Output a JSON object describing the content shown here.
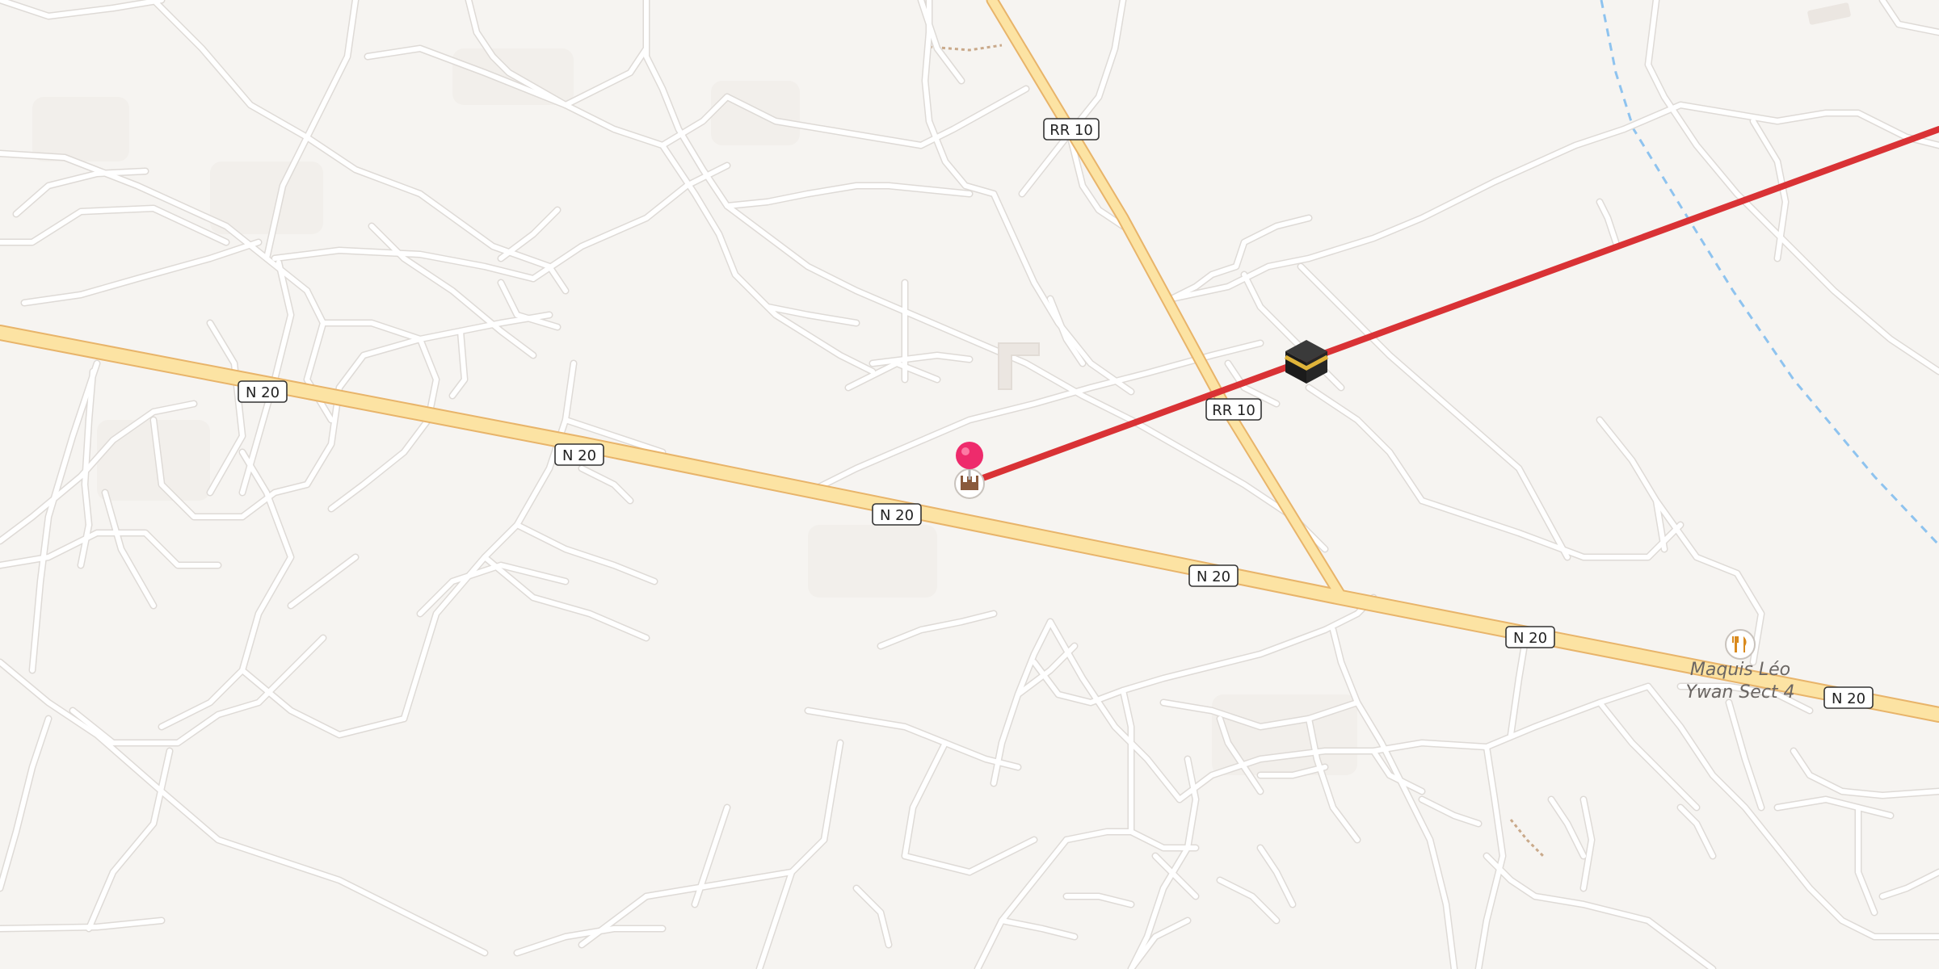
{
  "map": {
    "colors": {
      "background": "#f6f4f1",
      "minor_road": "#ffffff",
      "minor_road_casing": "#dedad6",
      "major_road_fill": "#fce3a3",
      "major_road_casing": "#e8b46a",
      "qibla_line": "#d93235",
      "waterway": "#8ec3ef",
      "pin": "#ee2b6c"
    },
    "road_labels": {
      "rr10_north": "RR 10",
      "rr10_center": "RR 10",
      "n20_west": "N 20",
      "n20_mid": "N 20",
      "n20_center": "N 20",
      "n20_east1": "N 20",
      "n20_east2": "N 20",
      "n20_far_east": "N 20"
    },
    "poi": {
      "restaurant_name_line1": "Maquis Léo",
      "restaurant_name_line2": "Ywan Sect 4",
      "restaurant_icon": "fork-knife-icon",
      "mosque_icon": "mosque-icon",
      "kaaba_icon": "kaaba-icon",
      "pin_icon": "location-pin-icon"
    }
  }
}
